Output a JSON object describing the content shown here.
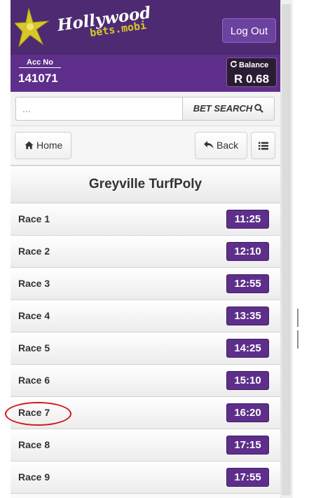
{
  "header": {
    "logo_text_main": "Hollywood",
    "logo_text_sub": "bets.mobi",
    "logout_label": "Log Out"
  },
  "account": {
    "acc_label": "Acc No",
    "acc_number": "141071",
    "balance_label": "Balance",
    "balance_value": "R 0.68"
  },
  "search": {
    "placeholder": "...",
    "button_label": "BET SEARCH",
    "icon": "search-icon"
  },
  "nav": {
    "home_label": "Home",
    "back_label": "Back",
    "home_icon": "home-icon",
    "back_icon": "reply-icon",
    "menu_icon": "list-icon"
  },
  "page_title": "Greyville TurfPoly",
  "races": [
    {
      "label": "Race 1",
      "time": "11:25"
    },
    {
      "label": "Race 2",
      "time": "12:10"
    },
    {
      "label": "Race 3",
      "time": "12:55"
    },
    {
      "label": "Race 4",
      "time": "13:35"
    },
    {
      "label": "Race 5",
      "time": "14:25"
    },
    {
      "label": "Race 6",
      "time": "15:10"
    },
    {
      "label": "Race 7",
      "time": "16:20"
    },
    {
      "label": "Race 8",
      "time": "17:15"
    },
    {
      "label": "Race 9",
      "time": "17:55"
    }
  ],
  "colors": {
    "brand_purple": "#4d2a72",
    "time_badge": "#5e2f8a",
    "highlight": "#d0161b"
  }
}
